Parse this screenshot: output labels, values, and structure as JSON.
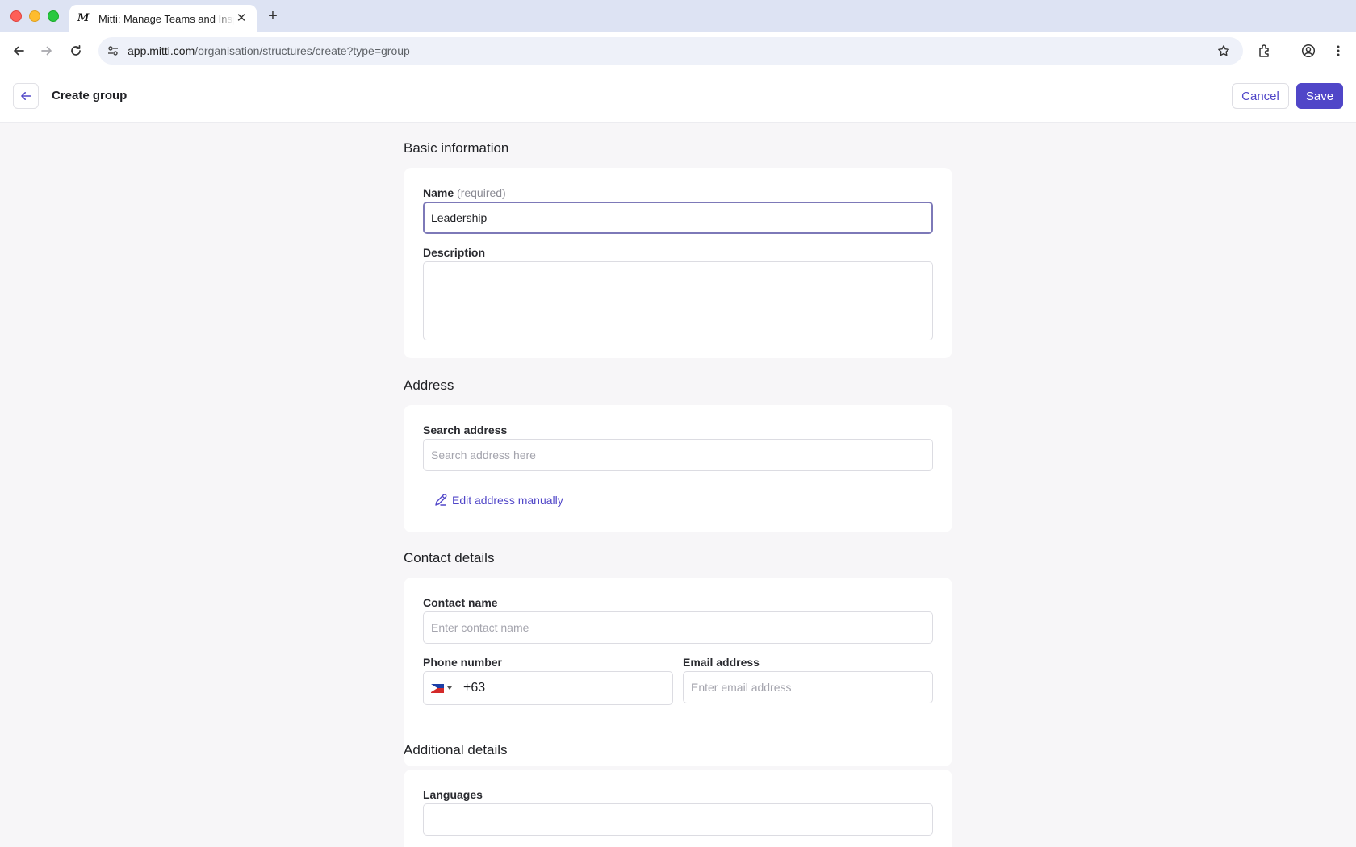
{
  "browser": {
    "tab_title": "Mitti: Manage Teams and Inspections",
    "tab_favicon_letter": "M",
    "url_host": "app.mitti.com",
    "url_path": "/organisation/structures/create?type=group"
  },
  "header": {
    "title": "Create group",
    "cancel_label": "Cancel",
    "save_label": "Save"
  },
  "sections": {
    "basic": {
      "title": "Basic information",
      "name_label": "Name",
      "name_required": "(required)",
      "name_value": "Leadership",
      "description_label": "Description",
      "description_value": ""
    },
    "address": {
      "title": "Address",
      "search_label": "Search address",
      "search_placeholder": "Search address here",
      "edit_manually_label": "Edit address manually"
    },
    "contact": {
      "title": "Contact details",
      "contact_name_label": "Contact name",
      "contact_name_placeholder": "Enter contact name",
      "phone_label": "Phone number",
      "phone_country_code": "+63",
      "email_label": "Email address",
      "email_placeholder": "Enter email address"
    },
    "additional": {
      "title": "Additional details",
      "languages_label": "Languages"
    }
  },
  "colors": {
    "accent": "#5046c8",
    "page_bg": "#f7f6f8",
    "chrome_bg": "#dde3f3"
  }
}
